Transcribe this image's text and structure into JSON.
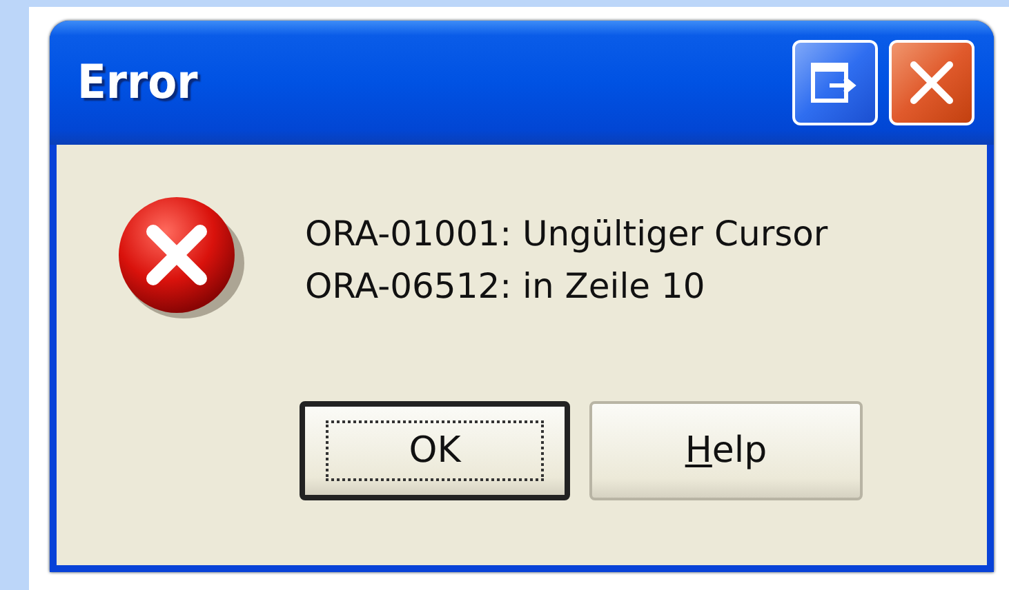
{
  "window": {
    "title": "Error"
  },
  "title_buttons": [
    {
      "kind": "restore"
    },
    {
      "kind": "close"
    }
  ],
  "message": {
    "lines": [
      "ORA-01001: Ungültiger Cursor",
      "ORA-06512: in Zeile 10"
    ]
  },
  "buttons": [
    {
      "label": "OK",
      "default": true,
      "underlined_initial": false
    },
    {
      "label": "Help",
      "default": false,
      "underlined_initial": true
    }
  ]
}
